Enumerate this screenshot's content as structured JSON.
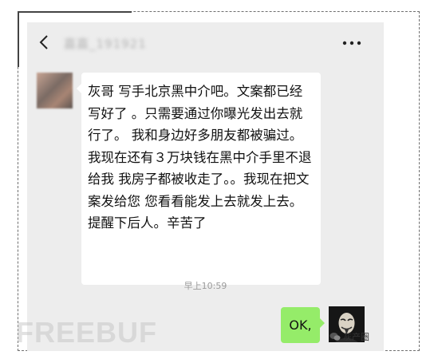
{
  "header": {
    "contact_name": "嘉嘉_191921"
  },
  "messages": {
    "incoming_text": "灰哥 写手北京黑中介吧。文案都已经写好了 。只需要通过你曝光发出去就行了。 我和身边好多朋友都被骗过。我现在还有３万块钱在黑中介手里不退给我 我房子都被收走了。。我现在把文案发给您 您看看能发上去就发上去。提醒下后人。辛苦了",
    "timestamp": "早上10:59",
    "outgoing_text": "OK,"
  },
  "watermarks": {
    "source": "灰产圈",
    "brand": "FREEBUF"
  },
  "colors": {
    "chat_background": "#ededed",
    "outgoing_bubble": "#95ec69",
    "incoming_bubble": "#ffffff"
  }
}
